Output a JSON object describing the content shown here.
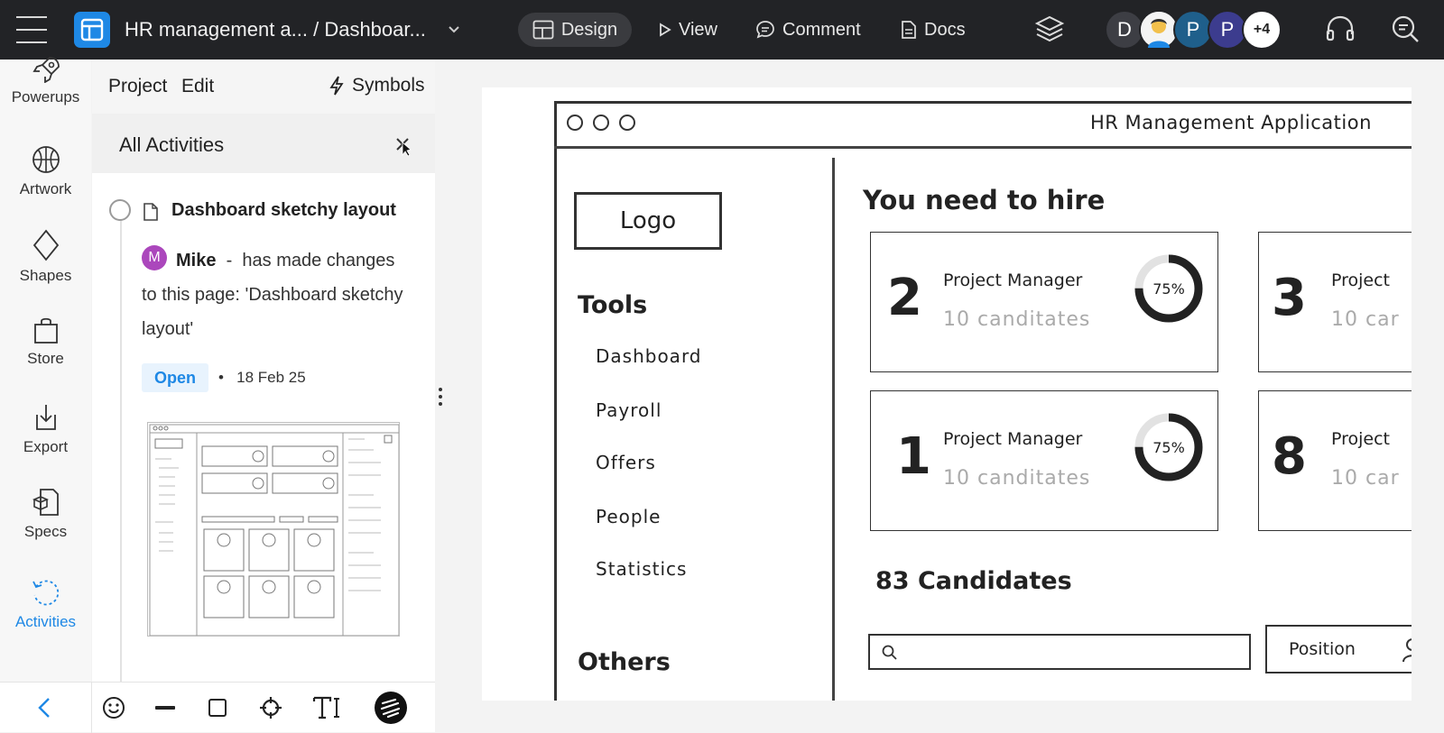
{
  "topbar": {
    "doc_title": "HR management a... / Dashboar...",
    "modes": {
      "design": "Design",
      "view": "View",
      "comment": "Comment",
      "docs": "Docs"
    },
    "collaborators": [
      {
        "initial": "D",
        "color": "#3d3e44"
      },
      {
        "initial": "",
        "color": "#f2c04c"
      },
      {
        "initial": "P",
        "color": "#1f5f8b"
      },
      {
        "initial": "P",
        "color": "#3c3c8e"
      }
    ],
    "more_count": "+4",
    "accent": "#1e88e5"
  },
  "rail": {
    "items": [
      {
        "label": "Powerups",
        "icon": "rocket-icon"
      },
      {
        "label": "Artwork",
        "icon": "basketball-icon"
      },
      {
        "label": "Shapes",
        "icon": "diamond-icon"
      },
      {
        "label": "Store",
        "icon": "shopping-bag-icon"
      },
      {
        "label": "Export",
        "icon": "export-icon"
      },
      {
        "label": "Specs",
        "icon": "specs-icon"
      },
      {
        "label": "Activities",
        "icon": "history-icon",
        "active": true
      }
    ]
  },
  "panel": {
    "tabs": {
      "project": "Project",
      "edit": "Edit",
      "symbols": "Symbols"
    },
    "header_title": "All Activities",
    "entry": {
      "title": "Dashboard sketchy layout",
      "avatar_initial": "M",
      "user": "Mike",
      "separator": "-",
      "message": "has made changes to this page: 'Dashboard sketchy layout'",
      "status": "Open",
      "dot": "•",
      "date": "18 Feb 25"
    }
  },
  "canvas": {
    "app_title": "HR Management Application",
    "logo": "Logo",
    "tools_heading": "Tools",
    "nav": [
      "Dashboard",
      "Payroll",
      "Offers",
      "People",
      "Statistics"
    ],
    "others_heading": "Others",
    "hire_heading": "You need to hire",
    "cards": [
      {
        "count": "2",
        "role": "Project Manager",
        "candidates": "10 canditates",
        "percent": "75%",
        "progress": 0.75
      },
      {
        "count": "3",
        "role": "Project",
        "candidates": "10 car",
        "percent": "",
        "progress": 0
      },
      {
        "count": "1",
        "role": "Project Manager",
        "candidates": "10 canditates",
        "percent": "75%",
        "progress": 0.75
      },
      {
        "count": "8",
        "role": "Project",
        "candidates": "10 car",
        "percent": "",
        "progress": 0
      }
    ],
    "candidates_heading": "83 Candidates",
    "position_filter": "Position"
  }
}
